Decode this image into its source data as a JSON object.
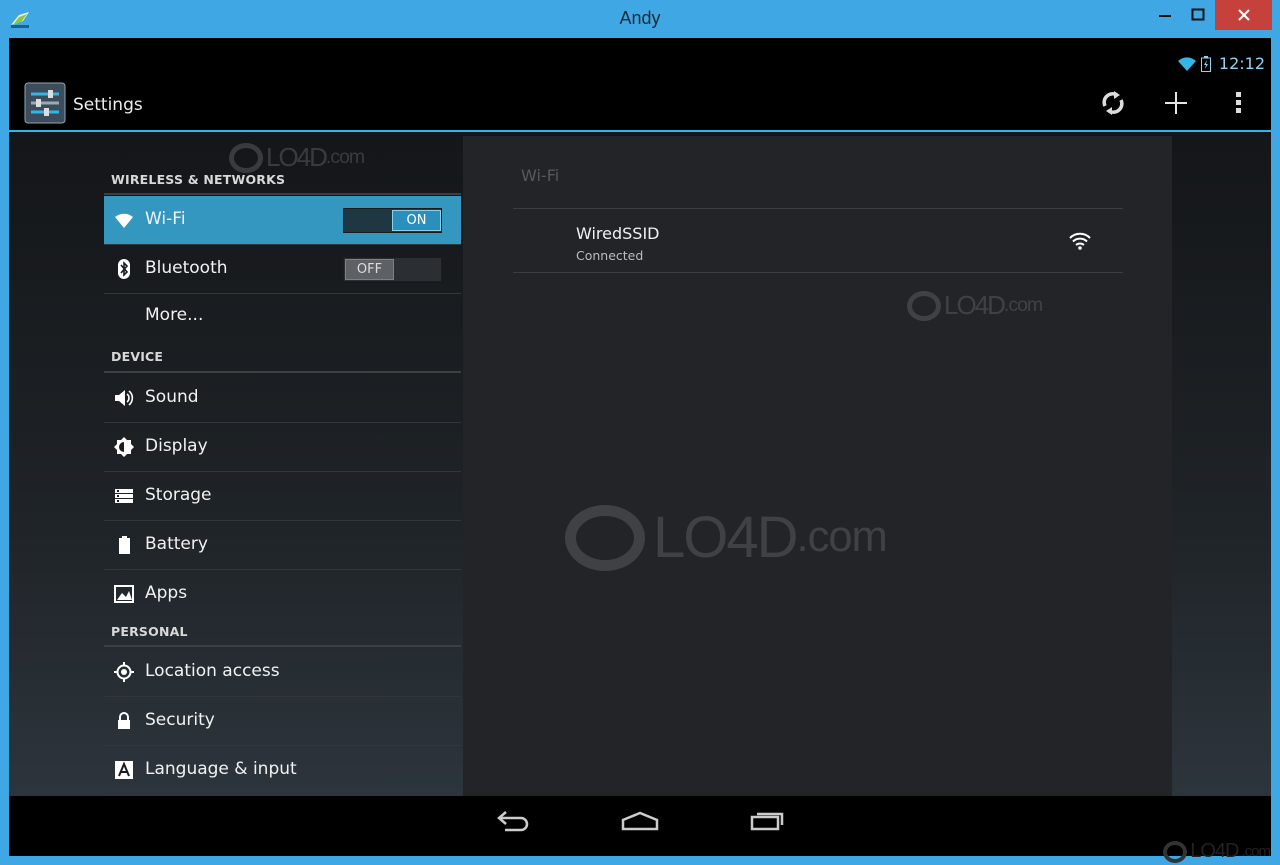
{
  "window": {
    "title": "Andy",
    "controls": {
      "minimize": "minimize",
      "maximize": "maximize",
      "close": "close"
    }
  },
  "status_bar": {
    "time": "12:12",
    "icons": [
      "wifi-icon",
      "battery-icon"
    ]
  },
  "action_bar": {
    "title": "Settings",
    "actions": [
      "sync-icon",
      "add-icon",
      "overflow-menu-icon"
    ]
  },
  "sidebar": {
    "sections": [
      {
        "header": "WIRELESS & NETWORKS",
        "items": [
          {
            "label": "Wi-Fi",
            "icon": "wifi-icon",
            "selected": true,
            "toggle": "ON"
          },
          {
            "label": "Bluetooth",
            "icon": "bluetooth-icon",
            "toggle": "OFF"
          },
          {
            "label": "More...",
            "icon": ""
          }
        ]
      },
      {
        "header": "DEVICE",
        "items": [
          {
            "label": "Sound",
            "icon": "speaker-icon"
          },
          {
            "label": "Display",
            "icon": "brightness-icon"
          },
          {
            "label": "Storage",
            "icon": "storage-icon"
          },
          {
            "label": "Battery",
            "icon": "battery-icon"
          },
          {
            "label": "Apps",
            "icon": "apps-icon"
          }
        ]
      },
      {
        "header": "PERSONAL",
        "items": [
          {
            "label": "Location access",
            "icon": "location-icon"
          },
          {
            "label": "Security",
            "icon": "lock-icon"
          },
          {
            "label": "Language & input",
            "icon": "language-icon"
          }
        ]
      }
    ]
  },
  "detail": {
    "header": "Wi-Fi",
    "networks": [
      {
        "name": "WiredSSID",
        "status": "Connected",
        "icon": "wifi-signal-icon"
      }
    ]
  },
  "watermarks": {
    "text": "LO4D",
    "suffix": ".com"
  },
  "nav_bar": {
    "buttons": [
      "back-icon",
      "home-icon",
      "recent-apps-icon"
    ]
  },
  "colors": {
    "accent": "#33b5e5",
    "selected": "#3397bf",
    "titlebar": "#3fa7e3",
    "close": "#c7413c"
  }
}
